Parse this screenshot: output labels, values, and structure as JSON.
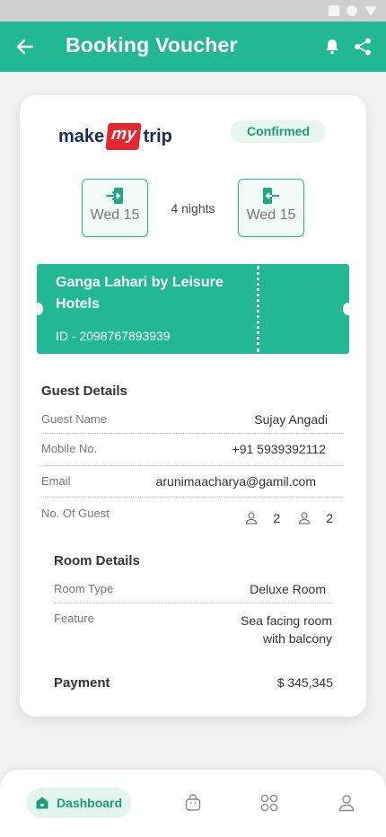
{
  "header": {
    "title": "Booking Voucher"
  },
  "booking": {
    "brand": {
      "part1": "make",
      "part2": "my",
      "part3": "trip"
    },
    "status": "Confirmed",
    "checkin_date": "Wed 15",
    "checkout_date": "Wed 15",
    "nights": "4 nights",
    "hotel_name": "Ganga Lahari by Leisure Hotels",
    "booking_id": "ID - 2098767893939"
  },
  "guest": {
    "title": "Guest Details",
    "rows": [
      {
        "label": "Guest Name",
        "value": "Sujay Angadi"
      },
      {
        "label": "Mobile No.",
        "value": "+91 5939392112"
      },
      {
        "label": "Email",
        "value": "arunimaacharya@gamil.com"
      },
      {
        "label": "No. Of Guest",
        "adults": "2",
        "children": "2"
      }
    ]
  },
  "room": {
    "title": "Room Details",
    "rows": [
      {
        "label": "Room Type",
        "value": "Deluxe Room"
      },
      {
        "label": "Feature",
        "value_line1": "Sea facing room",
        "value_line2": "with balcony"
      }
    ]
  },
  "payment": {
    "label": "Payment",
    "value": "$ 345,345"
  },
  "nav": {
    "dashboard": "Dashboard"
  },
  "colors": {
    "primary": "#21b893",
    "brand_red": "#e8262d",
    "brand_navy": "#1d2b5a"
  }
}
